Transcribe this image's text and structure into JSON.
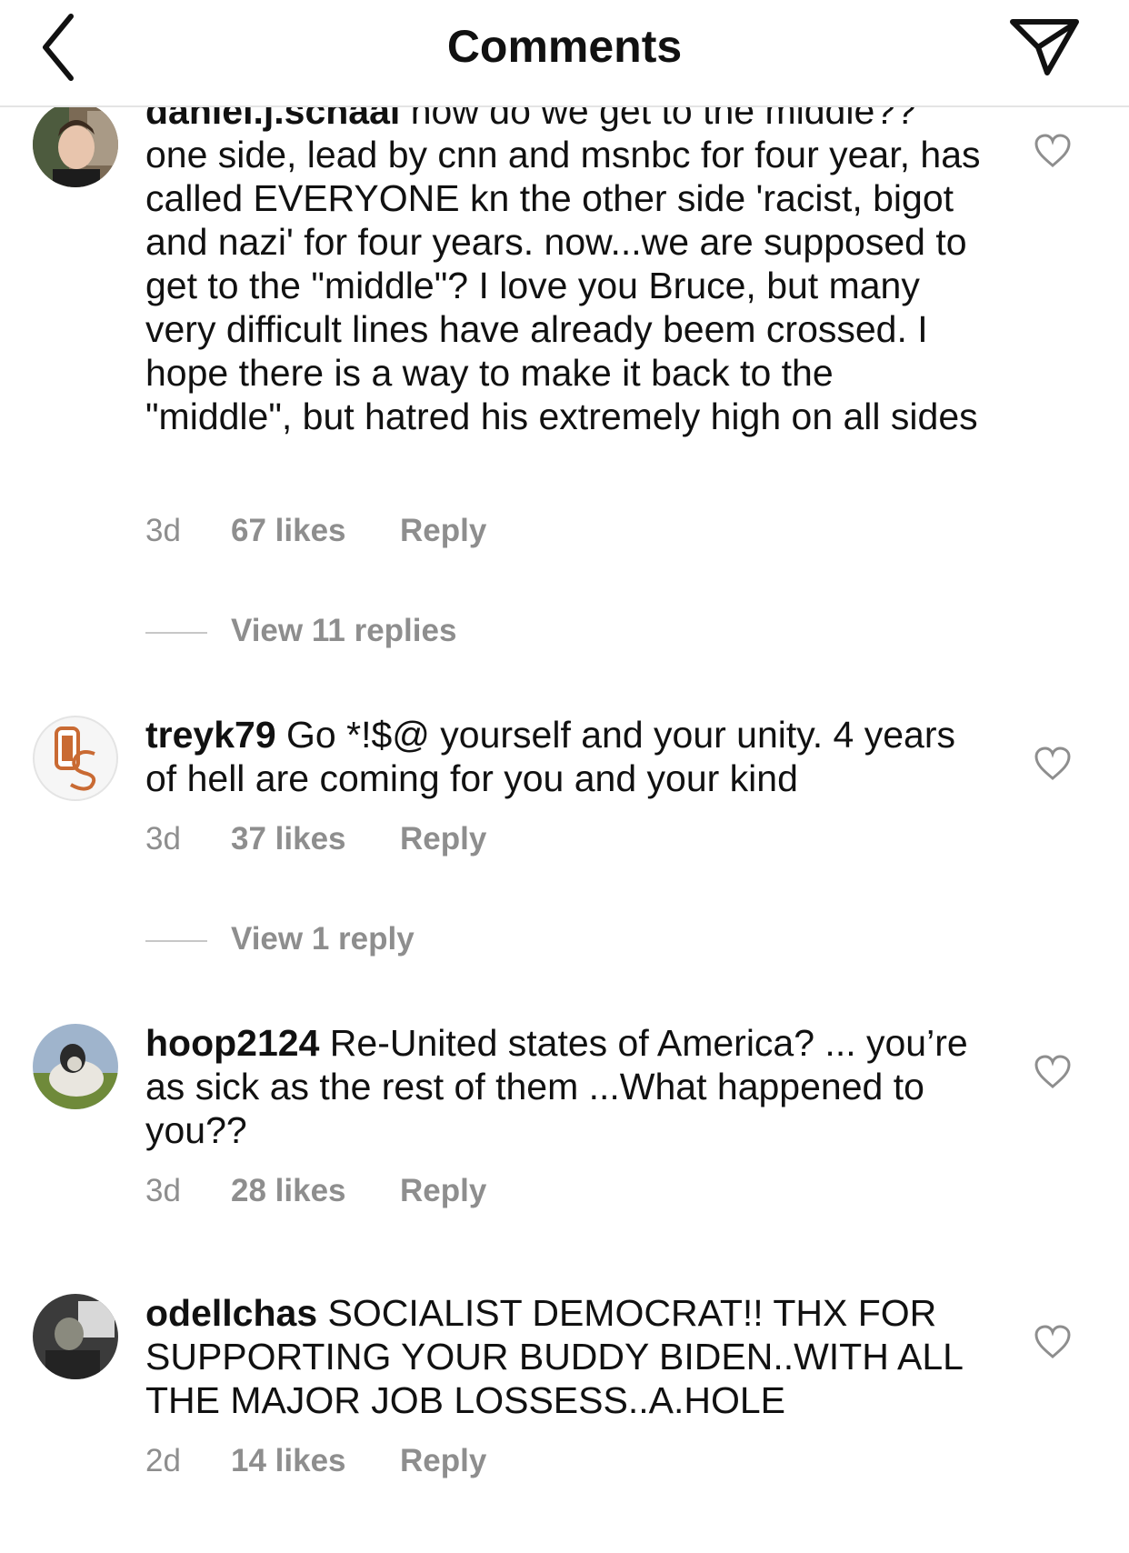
{
  "header": {
    "title": "Comments",
    "back_icon": "chevron-left-icon",
    "send_icon": "paper-plane-icon"
  },
  "comments": [
    {
      "username": "daniel.j.schaal",
      "text": "how do we get to the middle?? one side, lead by cnn and msnbc for four year, has called EVERYONE kn the other side 'racist, bigot and nazi' for four years.  now...we are supposed to get to the \"middle\"? I love you Bruce, but many very difficult lines have already beem crossed.  I hope there is a way to make it back to the \"middle\", but hatred his extremely high on all sides",
      "time": "3d",
      "likes": "67 likes",
      "reply": "Reply",
      "view_replies": "View 11 replies"
    },
    {
      "username": "treyk79",
      "text": "Go *!$@  yourself and your unity. 4 years of hell are coming for you and your kind",
      "time": "3d",
      "likes": "37 likes",
      "reply": "Reply",
      "view_replies": "View 1 reply",
      "avatar_logo_text": "OS"
    },
    {
      "username": "hoop2124",
      "text": "Re-United states of America? ... you’re as sick as the rest of them ...What happened to you??",
      "time": "3d",
      "likes": "28 likes",
      "reply": "Reply"
    },
    {
      "username": "odellchas",
      "text": "SOCIALIST DEMOCRAT!! THX FOR SUPPORTING YOUR BUDDY BIDEN..WITH ALL THE MAJOR JOB LOSSESS..A.HOLE",
      "time": "2d",
      "likes": "14 likes",
      "reply": "Reply"
    }
  ],
  "colors": {
    "text": "#111111",
    "meta": "#8e8e8e",
    "divider": "#e4e4e4",
    "logo_orange": "#c96a33"
  }
}
